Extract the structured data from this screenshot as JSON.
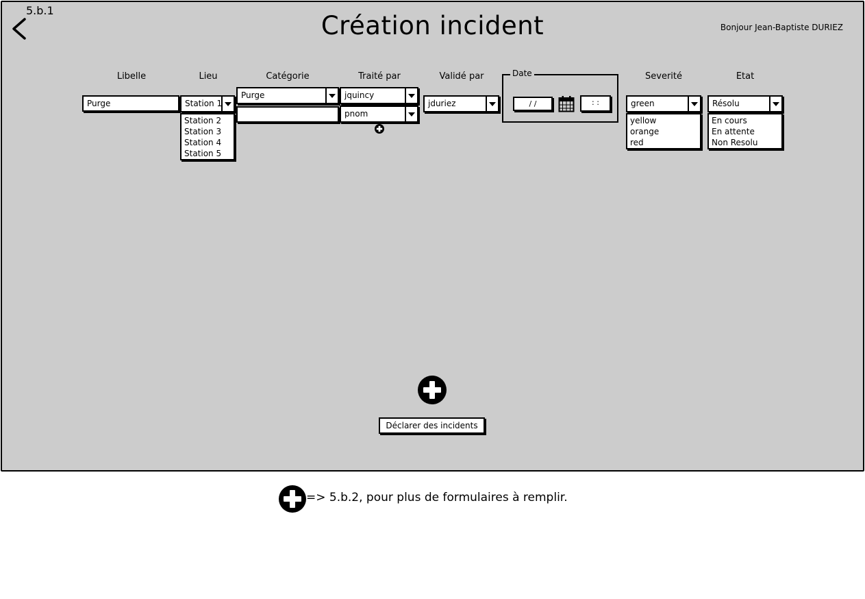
{
  "screen_id": "5.b.1",
  "title": "Création incident",
  "greeting": "Bonjour Jean-Baptiste DURIEZ",
  "columns": {
    "libelle": "Libelle",
    "lieu": "Lieu",
    "categorie": "Catégorie",
    "traite_par": "Traité par",
    "valide_par": "Validé par",
    "date": "Date",
    "severite": "Severité",
    "etat": "Etat"
  },
  "form": {
    "libelle_value": "Purge",
    "lieu_value": "Station 1",
    "lieu_options": [
      "Station 2",
      "Station 3",
      "Station 4",
      "Station 5"
    ],
    "categorie_value": "Purge",
    "categorie_second_value": "",
    "traite_par_values": [
      "jquincy",
      "pnom"
    ],
    "valide_par_value": "jduriez",
    "date_value": "/ /",
    "time_value": ": :",
    "severite_value": "green",
    "severite_options": [
      "yellow",
      "orange",
      "red"
    ],
    "etat_value": "Résolu",
    "etat_options": [
      "En cours",
      "En attente",
      "Non Resolu"
    ]
  },
  "declare_button": "Déclarer des incidents",
  "note": "=> 5.b.2, pour plus de formulaires à remplir."
}
